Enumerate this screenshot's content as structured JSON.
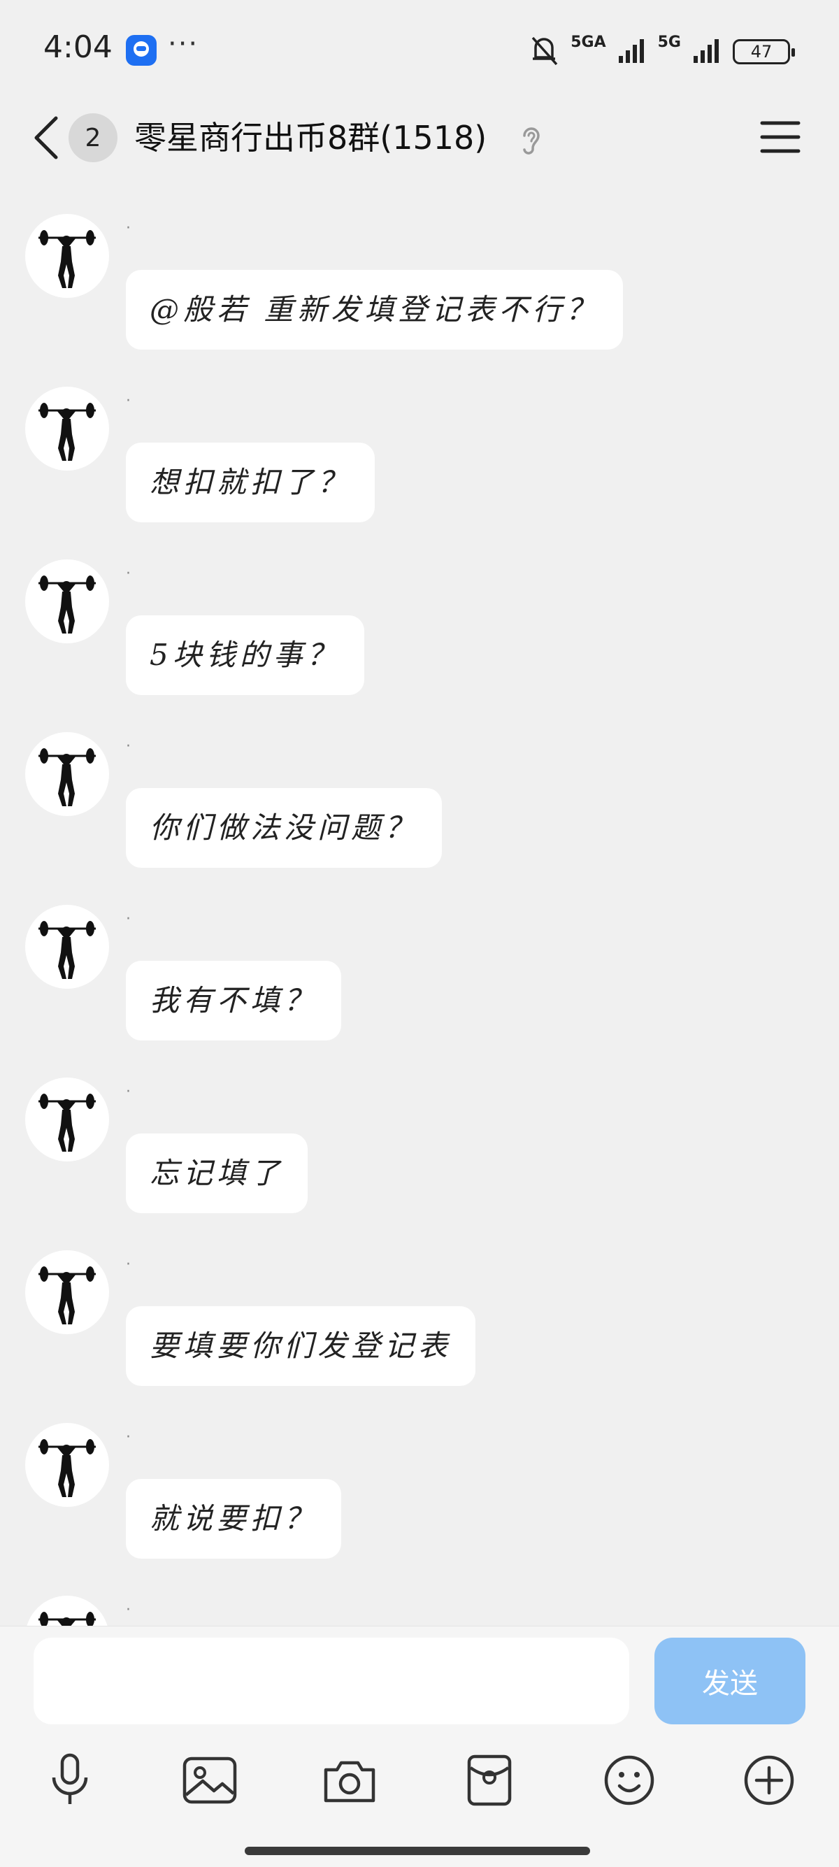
{
  "status_bar": {
    "time": "4:04",
    "more": "···",
    "signal1": "5GA",
    "signal2": "5G",
    "battery": "47"
  },
  "header": {
    "unread_count": "2",
    "title": "零星商行出币8群(1518)"
  },
  "messages": [
    {
      "nickname": "·",
      "text": "@般若 重新发填登记表不行？"
    },
    {
      "nickname": "·",
      "text": "想扣就扣了？"
    },
    {
      "nickname": "·",
      "text": "5块钱的事？"
    },
    {
      "nickname": "·",
      "text": "你们做法没问题？"
    },
    {
      "nickname": "·",
      "text": "我有不填？"
    },
    {
      "nickname": "·",
      "text": "忘记填了"
    },
    {
      "nickname": "·",
      "text": "要填要你们发登记表"
    },
    {
      "nickname": "·",
      "text": "就说要扣？"
    },
    {
      "nickname": "·",
      "text": ""
    }
  ],
  "input": {
    "value": "",
    "placeholder": "",
    "send_label": "发送"
  },
  "toolbar": [
    "microphone-icon",
    "image-icon",
    "camera-icon",
    "red-packet-icon",
    "emoji-icon",
    "plus-icon"
  ],
  "colors": {
    "background": "#f0f0f0",
    "bubble": "#ffffff",
    "send_button": "#8ec2f5",
    "accent": "#1e6ff2"
  }
}
